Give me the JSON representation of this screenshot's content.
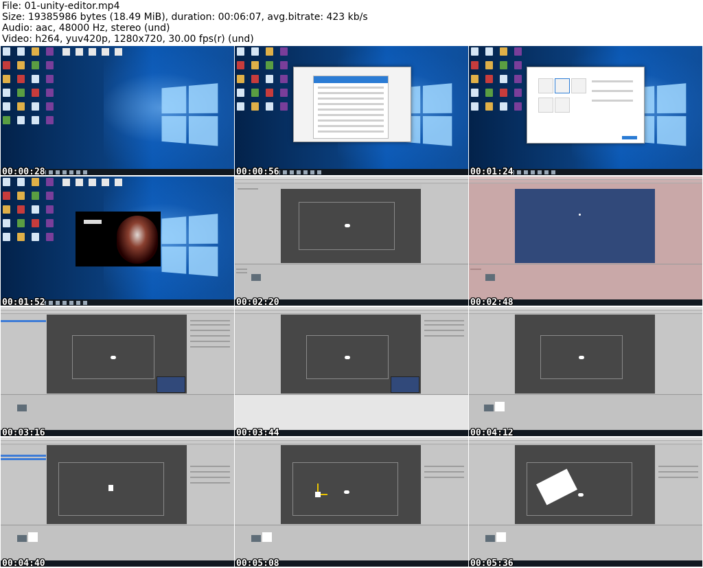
{
  "header": {
    "file": "File: 01-unity-editor.mp4",
    "size": "Size: 19385986 bytes (18.49 MiB), duration: 00:06:07, avg.bitrate: 423 kb/s",
    "audio": "Audio: aac, 48000 Hz, stereo (und)",
    "video": "Video: h264, yuv420p, 1280x720, 30.00 fps(r) (und)"
  },
  "thumbnails": [
    {
      "timestamp": "00:00:28",
      "scene": "windows-desktop"
    },
    {
      "timestamp": "00:00:56",
      "scene": "unity-hub-add-version"
    },
    {
      "timestamp": "00:01:24",
      "scene": "unity-hub-new-project"
    },
    {
      "timestamp": "00:01:52",
      "scene": "unity-splash"
    },
    {
      "timestamp": "00:02:20",
      "scene": "unity-editor-empty"
    },
    {
      "timestamp": "00:02:48",
      "scene": "unity-editor-play-mode"
    },
    {
      "timestamp": "00:03:16",
      "scene": "unity-editor-camera-selected"
    },
    {
      "timestamp": "00:03:44",
      "scene": "unity-editor-camera-preview"
    },
    {
      "timestamp": "00:04:12",
      "scene": "unity-editor-sprite-imported"
    },
    {
      "timestamp": "00:04:40",
      "scene": "unity-editor-sprite-in-scene"
    },
    {
      "timestamp": "00:05:08",
      "scene": "unity-editor-sprite-move-tool"
    },
    {
      "timestamp": "00:05:36",
      "scene": "unity-editor-sprite-rotated"
    }
  ]
}
